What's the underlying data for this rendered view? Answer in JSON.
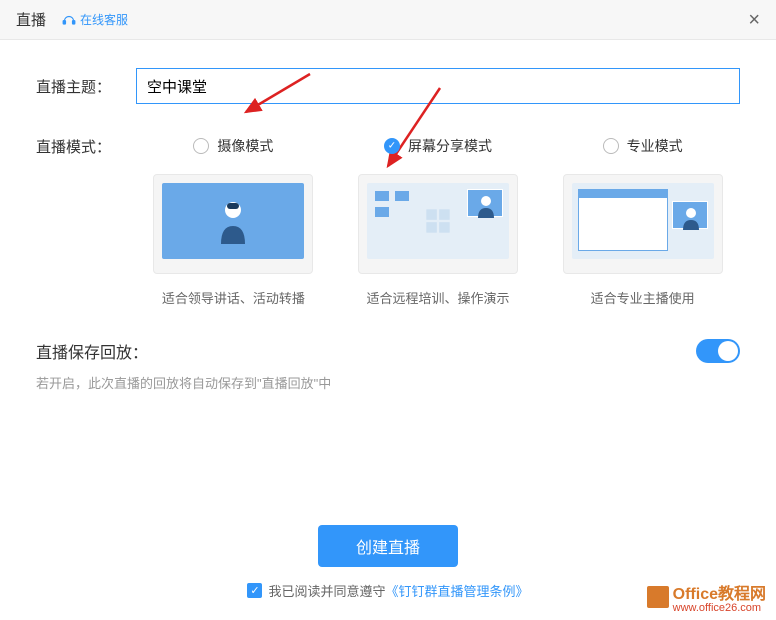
{
  "header": {
    "title": "直播",
    "online_service": "在线客服"
  },
  "form": {
    "topic_label": "直播主题：",
    "topic_value": "空中课堂",
    "mode_label": "直播模式：",
    "modes": [
      {
        "label": "摄像模式",
        "desc": "适合领导讲话、活动转播",
        "selected": false
      },
      {
        "label": "屏幕分享模式",
        "desc": "适合远程培训、操作演示",
        "selected": true
      },
      {
        "label": "专业模式",
        "desc": "适合专业主播使用",
        "selected": false
      }
    ]
  },
  "save": {
    "title": "直播保存回放：",
    "hint": "若开启，此次直播的回放将自动保存到\"直播回放\"中",
    "enabled": true
  },
  "footer": {
    "create_btn": "创建直播",
    "agree_text": "我已阅读并同意遵守",
    "terms_link": "《钉钉群直播管理条例》"
  },
  "watermark": {
    "text1": "Office教程网",
    "text2": "www.office26.com"
  }
}
